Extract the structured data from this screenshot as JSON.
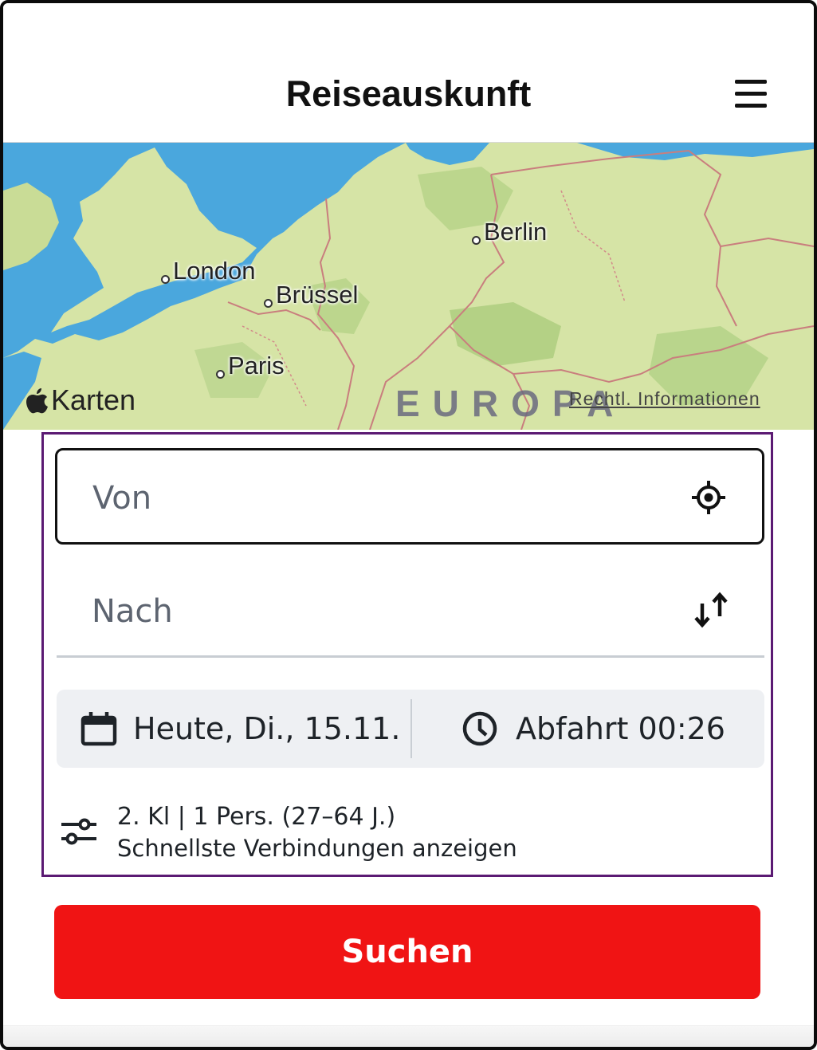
{
  "header": {
    "title": "Reiseauskunft",
    "menu_icon": "hamburger-menu-icon"
  },
  "map": {
    "cities": [
      {
        "id": "london",
        "label": "London"
      },
      {
        "id": "bruessel",
        "label": "Brüssel"
      },
      {
        "id": "paris",
        "label": "Paris"
      },
      {
        "id": "berlin",
        "label": "Berlin"
      }
    ],
    "logo_text": "Karten",
    "region_label": "EUROPA",
    "legal_link": "Rechtl. Informationen",
    "colors": {
      "land": "#d6e4a6",
      "water": "#4aa7dd",
      "forest": "#b9d58c",
      "border": "#c97e7e"
    }
  },
  "form": {
    "from_placeholder": "Von",
    "to_placeholder": "Nach",
    "date_label": "Heute, Di., 15.11.",
    "time_label": "Abfahrt 00:26",
    "options_line1": "2. Kl | 1 Pers. (27–64 J.)",
    "options_line2": "Schnellste Verbindungen anzeigen",
    "icons": {
      "locate": "crosshair-location-icon",
      "swap": "swap-arrows-icon",
      "date": "calendar-icon",
      "time": "clock-icon",
      "options": "filter-sliders-icon"
    },
    "panel_outline_color": "#5b1a73"
  },
  "search_button": {
    "label": "Suchen",
    "color": "#f01414"
  }
}
